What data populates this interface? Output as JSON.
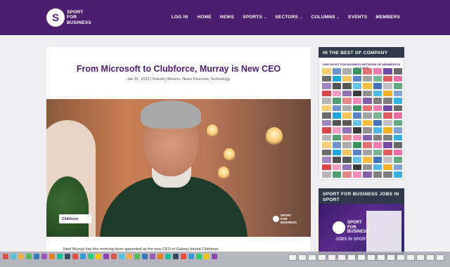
{
  "header": {
    "logo_mark": "S",
    "logo_lines": [
      "SPORT",
      "FOR",
      "BUSINESS"
    ],
    "nav": [
      {
        "label": "LOG IN",
        "has_dropdown": false
      },
      {
        "label": "HOME",
        "has_dropdown": false
      },
      {
        "label": "NEWS",
        "has_dropdown": false
      },
      {
        "label": "SPORTS",
        "has_dropdown": true
      },
      {
        "label": "SECTORS",
        "has_dropdown": true
      },
      {
        "label": "COLUMNS",
        "has_dropdown": true
      },
      {
        "label": "EVENTS",
        "has_dropdown": false
      },
      {
        "label": "MEMBERS",
        "has_dropdown": false
      }
    ]
  },
  "article": {
    "title": "From Microsoft to Clubforce, Murray is New CEO",
    "meta": "Jan 31, 2022 | Industry Movers, News Freeview, Technology",
    "image_badge_left": "Clubforce",
    "image_badge_right_lines": [
      "SPORT",
      "FOR",
      "BUSINESS"
    ],
    "body_start": "Noel Murray has this morning been appointed as the new CEO of Galway based Clubforce."
  },
  "sidebar": {
    "box1": {
      "heading": "IN THE BEST OF COMPANY",
      "inner_title": "OUR SPORT FOR BUSINESS NETWORK OF MEMBERS IN JULY 2022"
    },
    "box2": {
      "heading": "SPORT FOR BUSINESS JOBS IN SPORT",
      "logo_lines": [
        "SPORT",
        "FOR",
        "BUSINESS"
      ],
      "subtitle": "JOBS IN SPORT"
    }
  },
  "colors": {
    "brand_purple": "#4b1d6e",
    "sidebar_heading": "#2e3a4b",
    "page_bg": "#efeff1"
  }
}
